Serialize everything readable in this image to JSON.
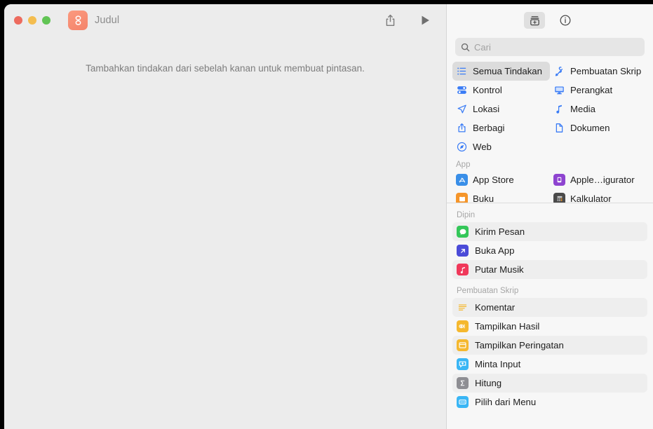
{
  "window": {
    "title": "Judul",
    "app_icon_name": "shortcuts-app-icon",
    "traffic_lights": [
      "close",
      "minimize",
      "zoom"
    ],
    "colors": {
      "accent_blue": "#3a7cf6",
      "app_icon": "#f4836a",
      "close": "#ed6b5e",
      "minimize": "#f4bd4f",
      "zoom": "#61c454"
    }
  },
  "editor": {
    "empty_hint": "Tambahkan tindakan dari sebelah kanan untuk membuat pintasan.",
    "share_label": "Bagikan",
    "run_label": "Jalankan"
  },
  "library": {
    "toolbar": {
      "action_library_label": "Pustaka Tindakan",
      "info_label": "Info"
    },
    "search": {
      "placeholder": "Cari",
      "value": ""
    },
    "categories": [
      {
        "label": "Semua Tindakan",
        "icon": "list-bullet-icon",
        "selected": true
      },
      {
        "label": "Pembuatan Skrip",
        "icon": "scripting-icon",
        "selected": false
      },
      {
        "label": "Kontrol",
        "icon": "controls-icon",
        "selected": false
      },
      {
        "label": "Perangkat",
        "icon": "device-icon",
        "selected": false
      },
      {
        "label": "Lokasi",
        "icon": "location-icon",
        "selected": false
      },
      {
        "label": "Media",
        "icon": "music-note-icon",
        "selected": false
      },
      {
        "label": "Berbagi",
        "icon": "share-icon",
        "selected": false
      },
      {
        "label": "Dokumen",
        "icon": "document-icon",
        "selected": false
      },
      {
        "label": "Web",
        "icon": "safari-icon",
        "selected": false
      }
    ],
    "app_section": {
      "header": "App",
      "apps": [
        {
          "label": "App Store",
          "icon": "app-store-icon",
          "color": "#3a8fe8"
        },
        {
          "label": "Apple…igurator",
          "icon": "apple-configurator-icon",
          "color": "#8e44d0"
        },
        {
          "label": "Buku",
          "icon": "books-icon",
          "color": "#f5952a"
        },
        {
          "label": "Kalkulator",
          "icon": "calculator-icon",
          "color": "#4a4a4a"
        }
      ]
    },
    "pinned_section": {
      "header": "Dipin",
      "items": [
        {
          "label": "Kirim Pesan",
          "icon": "messages-icon",
          "color": "#34c759",
          "alt": true
        },
        {
          "label": "Buka App",
          "icon": "open-app-icon",
          "color": "#4b4bd8",
          "alt": false
        },
        {
          "label": "Putar Musik",
          "icon": "music-icon",
          "color": "#f0385a",
          "alt": true
        }
      ]
    },
    "scripting_section": {
      "header": "Pembuatan Skrip",
      "items": [
        {
          "label": "Komentar",
          "icon": "comment-icon",
          "color": "#f5b82e",
          "alt": true
        },
        {
          "label": "Tampilkan Hasil",
          "icon": "show-result-icon",
          "color": "#f5b82e",
          "alt": false
        },
        {
          "label": "Tampilkan Peringatan",
          "icon": "show-alert-icon",
          "color": "#f5b82e",
          "alt": true
        },
        {
          "label": "Minta Input",
          "icon": "ask-input-icon",
          "color": "#3ab6f5",
          "alt": false
        },
        {
          "label": "Hitung",
          "icon": "calculate-icon",
          "color": "#8e8e93",
          "alt": true
        },
        {
          "label": "Pilih dari Menu",
          "icon": "choose-menu-icon",
          "color": "#3ab6f5",
          "alt": false
        }
      ]
    }
  }
}
